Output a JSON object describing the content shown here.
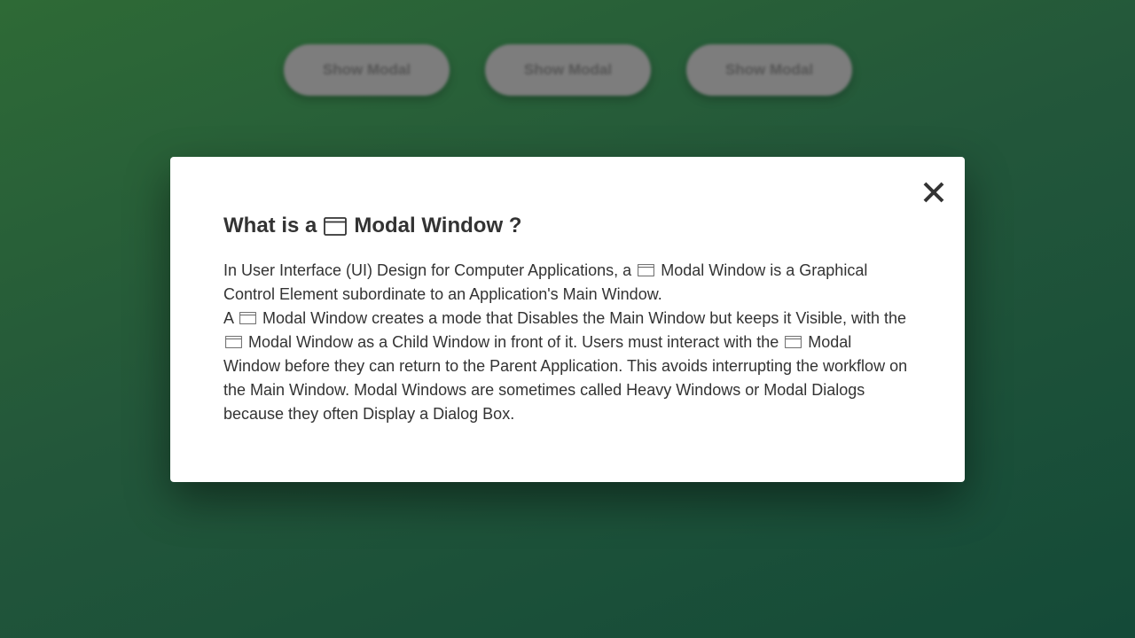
{
  "background_buttons": [
    {
      "label": "Show Modal"
    },
    {
      "label": "Show Modal"
    },
    {
      "label": "Show Modal"
    }
  ],
  "modal": {
    "close_icon": "close-icon",
    "title": {
      "before": "What is a",
      "icon": "window-icon",
      "after": "Modal Window ?"
    },
    "paragraph1": {
      "part1": "In User Interface (UI) Design for Computer Applications, a",
      "part2": "Modal Window is a Graphical Control Element subordinate to an Application's Main Window."
    },
    "paragraph2": {
      "part1": "A",
      "part2": "Modal Window creates a mode that Disables the Main Window but keeps it Visible, with the",
      "part3": "Modal Window as a Child Window in front of it. Users must interact with the",
      "part4": "Modal Window before they can return to the Parent Application. This avoids interrupting the workflow on the Main Window. Modal Windows are sometimes called Heavy Windows or Modal Dialogs because they often Display a Dialog Box."
    }
  },
  "colors": {
    "background_start": "#2e6a36",
    "background_end": "#144a38",
    "modal_background": "#ffffff",
    "text": "#333333",
    "button_background": "#7d7d7d"
  }
}
